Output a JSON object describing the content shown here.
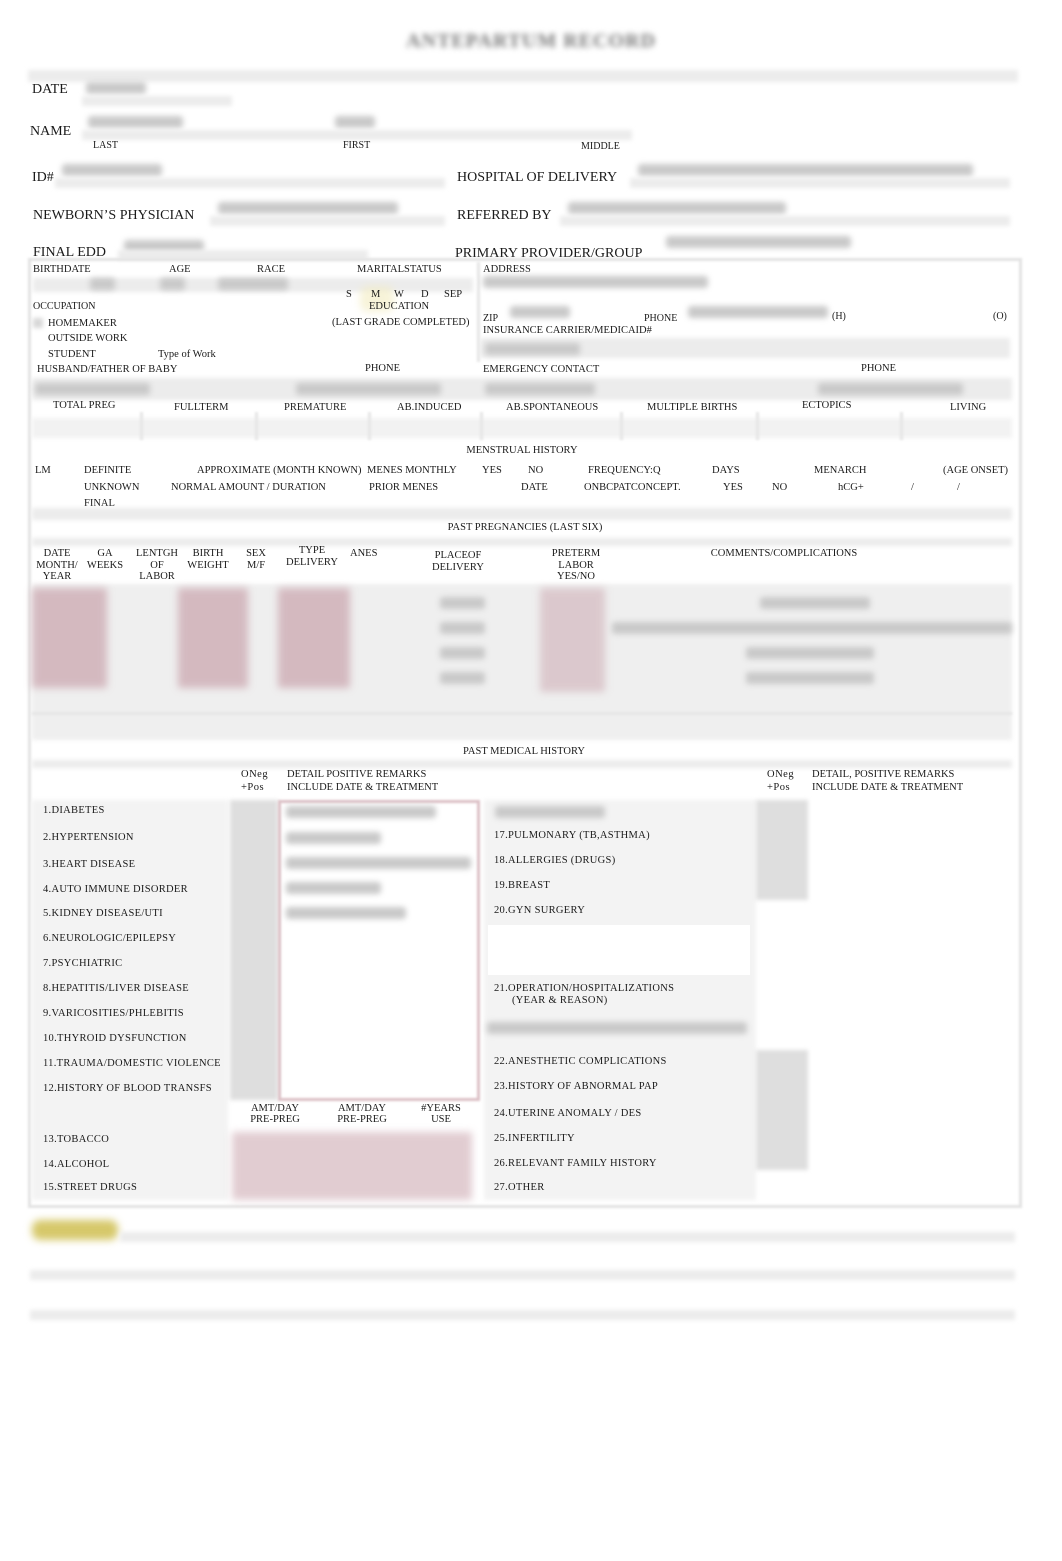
{
  "document": {
    "title": "ANTEPARTUM RECORD"
  },
  "header": {
    "date_label": "DATE",
    "date_value": "",
    "name_label": "NAME",
    "name_last_label": "LAST",
    "name_first_label": "FIRST",
    "name_middle_label": "MIDDLE",
    "name_last_value": "",
    "name_first_value": "",
    "id_label": "ID#",
    "id_value": "",
    "hospital_label": "HOSPITAL OF DELIVERY",
    "hospital_value": "",
    "newborn_physician_label": "NEWBORN’S PHYSICIAN",
    "newborn_physician_value": "",
    "referred_by_label": "REFERRED BY",
    "referred_by_value": "",
    "final_edd_label": "FINAL EDD",
    "final_edd_value": "",
    "primary_provider_label": "PRIMARY PROVIDER/GROUP",
    "primary_provider_value": ""
  },
  "demographics": {
    "birthdate_label": "BIRTHDATE",
    "age_label": "AGE",
    "race_label": "RACE",
    "marital_status_label": "MARITALSTATUS",
    "marital_options": [
      "S",
      "M",
      "W",
      "D",
      "SEP"
    ],
    "marital_selected": "M",
    "address_label": "ADDRESS",
    "occupation_label": "OCCUPATION",
    "occupation_options": [
      "HOMEMAKER",
      "OUTSIDE WORK",
      "STUDENT"
    ],
    "type_of_work_label": "Type of Work",
    "education_label": "EDUCATION",
    "education_sub_label": "(LAST GRADE COMPLETED)",
    "zip_label": "ZIP",
    "phone_label": "PHONE",
    "phone_home_suffix": "(H)",
    "phone_office_suffix": "(O)",
    "insurance_label": "INSURANCE CARRIER/MEDICAID#",
    "husband_label": "HUSBAND/FATHER OF BABY",
    "husband_phone_label": "PHONE",
    "emergency_label": "EMERGENCY CONTACT",
    "emergency_phone_label": "PHONE"
  },
  "obstetric_counts": {
    "labels": [
      "TOTAL PREG",
      "FULLTERM",
      "PREMATURE",
      "AB.INDUCED",
      "AB.SPONTANEOUS",
      "MULTIPLE BIRTHS",
      "ECTOPICS",
      "LIVING"
    ]
  },
  "menstrual_history": {
    "title": "MENSTRUAL HISTORY",
    "lm_label": "LM",
    "definite": "DEFINITE",
    "unknown": "UNKNOWN",
    "final": "FINAL",
    "approximate": "APPROXIMATE (MONTH KNOWN)",
    "normal_amount": "NORMAL AMOUNT / DURATION",
    "menes_monthly": "MENES MONTHLY",
    "prior_menes": "PRIOR MENES",
    "yes": "YES",
    "no": "NO",
    "date": "DATE",
    "frequency": "FREQUENCY:Q",
    "days": "DAYS",
    "onbcp": "ONBCPATCONCEPT.",
    "yes2": "YES",
    "no2": "NO",
    "menarch": "MENARCH",
    "age_onset": "(AGE ONSET)",
    "hcg": "hCG+",
    "slash1": "/",
    "slash2": "/"
  },
  "past_pregnancies": {
    "title": "PAST PREGNANCIES (LAST SIX)",
    "columns": [
      "DATE MONTH/ YEAR",
      "GA WEEKS",
      "LENTGH OF LABOR",
      "BIRTH WEIGHT",
      "SEX M/F",
      "TYPE DELIVERY",
      "ANES",
      "PLACEOF DELIVERY",
      "PRETERM LABOR YES/NO",
      "COMMENTS/COMPLICATIONS"
    ],
    "rows": [
      [
        "",
        "",
        "",
        "",
        "",
        "",
        "",
        "",
        "",
        ""
      ],
      [
        "",
        "",
        "",
        "",
        "",
        "",
        "",
        "",
        "",
        ""
      ],
      [
        "",
        "",
        "",
        "",
        "",
        "",
        "",
        "",
        "",
        ""
      ],
      [
        "",
        "",
        "",
        "",
        "",
        "",
        "",
        "",
        "",
        ""
      ],
      [
        "",
        "",
        "",
        "",
        "",
        "",
        "",
        "",
        "",
        ""
      ],
      [
        "",
        "",
        "",
        "",
        "",
        "",
        "",
        "",
        "",
        ""
      ]
    ]
  },
  "past_medical_history": {
    "title": "PAST MEDICAL HISTORY",
    "neg_pos_label_1": "ONeg",
    "neg_pos_label_2": "+Pos",
    "left_detail_1": "DETAIL POSITIVE REMARKS",
    "left_detail_2": "INCLUDE DATE & TREATMENT",
    "right_detail_1": "DETAIL, POSITIVE REMARKS",
    "right_detail_2": "INCLUDE DATE & TREATMENT",
    "left_items": [
      "1.DIABETES",
      "2.HYPERTENSION",
      "3.HEART DISEASE",
      "4.AUTO IMMUNE DISORDER",
      "5.KIDNEY DISEASE/UTI",
      "6.NEUROLOGIC/EPILEPSY",
      "7.PSYCHIATRIC",
      "8.HEPATITIS/LIVER DISEASE",
      "9.VARICOSITIES/PHLEBITIS",
      "10.THYROID DYSFUNCTION",
      "11.TRAUMA/DOMESTIC VIOLENCE",
      "12.HISTORY OF BLOOD TRANSFS"
    ],
    "substance_headers": [
      "AMT/DAY\nPRE-PREG",
      "AMT/DAY\nPRE-PREG",
      "#YEARS\nUSE"
    ],
    "substance_items": [
      "13.TOBACCO",
      "14.ALCOHOL",
      "15.STREET DRUGS"
    ],
    "right_items": [
      "17.PULMONARY (TB,ASTHMA)",
      "18.ALLERGIES (DRUGS)",
      "19.BREAST",
      "20.GYN SURGERY",
      "21.OPERATION/HOSPITALIZATIONS",
      "22.ANESTHETIC COMPLICATIONS",
      "23.HISTORY OF ABNORMAL PAP",
      "24.UTERINE ANOMALY / DES",
      "25.INFERTILITY",
      "26.RELEVANT FAMILY HISTORY",
      "27.OTHER"
    ],
    "item21_sub": "(YEAR & REASON)"
  },
  "colors": {
    "highlight": "#d6c86a",
    "pink_fill": "#c9a3ac",
    "band_gray": "#ececec"
  }
}
